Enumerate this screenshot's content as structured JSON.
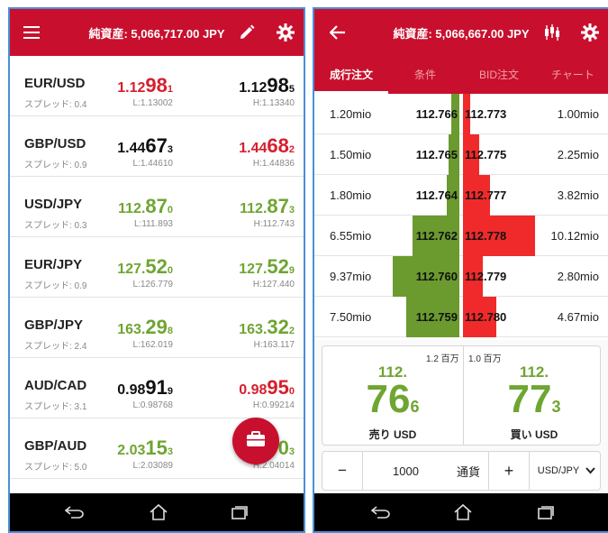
{
  "left": {
    "appbar": {
      "title": "純資産: 5,066,717.00 JPY",
      "menu_icon": "menu-icon",
      "edit_icon": "pencil-icon",
      "settings_icon": "gear-icon"
    },
    "quotes": [
      {
        "symbol": "EUR/USD",
        "spread": "スプレッド: 0.4",
        "bid": {
          "pre": "1.12",
          "big": "98",
          "small": "1",
          "color": "#d71e2c"
        },
        "ask": {
          "pre": "1.12",
          "big": "98",
          "small": "5",
          "color": "#111111"
        },
        "low": "L:1.13002",
        "high": "H:1.13340"
      },
      {
        "symbol": "GBP/USD",
        "spread": "スプレッド: 0.9",
        "bid": {
          "pre": "1.44",
          "big": "67",
          "small": "3",
          "color": "#111111"
        },
        "ask": {
          "pre": "1.44",
          "big": "68",
          "small": "2",
          "color": "#d71e2c"
        },
        "low": "L:1.44610",
        "high": "H:1.44836"
      },
      {
        "symbol": "USD/JPY",
        "spread": "スプレッド: 0.3",
        "bid": {
          "pre": "112.",
          "big": "87",
          "small": "0",
          "color": "#6fa532"
        },
        "ask": {
          "pre": "112.",
          "big": "87",
          "small": "3",
          "color": "#6fa532"
        },
        "low": "L:111.893",
        "high": "H:112.743"
      },
      {
        "symbol": "EUR/JPY",
        "spread": "スプレッド: 0.9",
        "bid": {
          "pre": "127.",
          "big": "52",
          "small": "0",
          "color": "#6fa532"
        },
        "ask": {
          "pre": "127.",
          "big": "52",
          "small": "9",
          "color": "#6fa532"
        },
        "low": "L:126.779",
        "high": "H:127.440"
      },
      {
        "symbol": "GBP/JPY",
        "spread": "スプレッド: 2.4",
        "bid": {
          "pre": "163.",
          "big": "29",
          "small": "8",
          "color": "#6fa532"
        },
        "ask": {
          "pre": "163.",
          "big": "32",
          "small": "2",
          "color": "#6fa532"
        },
        "low": "L:162.019",
        "high": "H:163.117"
      },
      {
        "symbol": "AUD/CAD",
        "spread": "スプレッド: 3.1",
        "bid": {
          "pre": "0.98",
          "big": "91",
          "small": "9",
          "color": "#111111"
        },
        "ask": {
          "pre": "0.98",
          "big": "95",
          "small": "0",
          "color": "#d71e2c"
        },
        "low": "L:0.98768",
        "high": "H:0.99214"
      },
      {
        "symbol": "GBP/AUD",
        "spread": "スプレッド: 5.0",
        "bid": {
          "pre": "2.03",
          "big": "15",
          "small": "3",
          "color": "#6fa532"
        },
        "ask": {
          "pre": "",
          "big": "0",
          "small": "3",
          "color": "#6fa532"
        },
        "low": "L:2.03089",
        "high": "H:2.04014"
      }
    ],
    "fab_icon": "briefcase-icon"
  },
  "right": {
    "appbar": {
      "title": "純資産: 5,066,667.00 JPY",
      "back_icon": "back-arrow-icon",
      "candles_icon": "candlestick-icon",
      "settings_icon": "gear-icon"
    },
    "tabs": [
      {
        "label": "成行注文",
        "active": true
      },
      {
        "label": "条件"
      },
      {
        "label": "BID注文"
      },
      {
        "label": "チャート"
      }
    ],
    "book": [
      {
        "bid_size": "1.20mio",
        "bid": "112.766",
        "ask": "112.773",
        "ask_size": "1.00mio",
        "bid_vol": 1.2,
        "ask_vol": 1.0
      },
      {
        "bid_size": "1.50mio",
        "bid": "112.765",
        "ask": "112.775",
        "ask_size": "2.25mio",
        "bid_vol": 1.5,
        "ask_vol": 2.25
      },
      {
        "bid_size": "1.80mio",
        "bid": "112.764",
        "ask": "112.777",
        "ask_size": "3.82mio",
        "bid_vol": 1.8,
        "ask_vol": 3.82
      },
      {
        "bid_size": "6.55mio",
        "bid": "112.762",
        "ask": "112.778",
        "ask_size": "10.12mio",
        "bid_vol": 6.55,
        "ask_vol": 10.12
      },
      {
        "bid_size": "9.37mio",
        "bid": "112.760",
        "ask": "112.779",
        "ask_size": "2.80mio",
        "bid_vol": 9.37,
        "ask_vol": 2.8
      },
      {
        "bid_size": "7.50mio",
        "bid": "112.759",
        "ask": "112.780",
        "ask_size": "4.67mio",
        "bid_vol": 7.5,
        "ask_vol": 4.67
      }
    ],
    "trade": {
      "sell": {
        "volume": "1.2 百万",
        "int": "112.",
        "big": "76",
        "small": "6",
        "label": "売り USD"
      },
      "buy": {
        "volume": "1.0 百万",
        "int": "112.",
        "big": "77",
        "small": "3",
        "label": "買い USD"
      }
    },
    "qty": {
      "minus": "−",
      "amount": "1000",
      "unit": "通貨",
      "plus": "+",
      "pair": "USD/JPY"
    }
  },
  "navbar": {
    "back_icon": "nav-back-icon",
    "home_icon": "nav-home-icon",
    "recents_icon": "nav-recents-icon"
  },
  "colors": {
    "brand": "#c8102e",
    "up": "#6fa532",
    "down": "#d71e2c",
    "bid_bar": "#6b9a2e",
    "ask_bar": "#f02a2a"
  }
}
